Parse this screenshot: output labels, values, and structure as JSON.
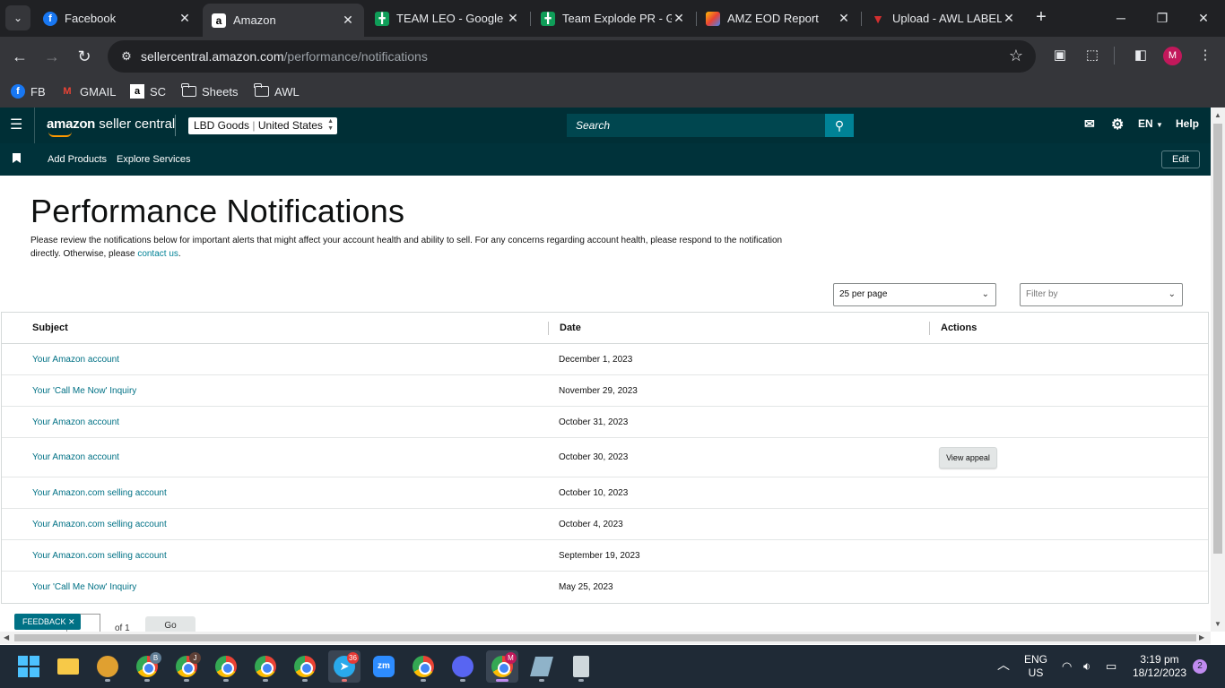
{
  "browser": {
    "tabs": [
      {
        "title": "Facebook",
        "icon": "facebook-icon",
        "color": "#1877f2"
      },
      {
        "title": "Amazon",
        "icon": "amazon-icon",
        "color": "#000000",
        "active": true
      },
      {
        "title": "TEAM LEO - Google S",
        "icon": "google-sheets-icon",
        "color": "#0f9d58"
      },
      {
        "title": "Team Explode PR - G",
        "icon": "google-sheets-icon",
        "color": "#0f9d58"
      },
      {
        "title": "AMZ EOD Report",
        "icon": "report-icon",
        "color": "#f4511e"
      },
      {
        "title": "Upload - AWL LABEL",
        "icon": "awl-label-icon",
        "color": "#d32f2f"
      }
    ],
    "url_host": "sellercentral.amazon.com",
    "url_path": "/performance/notifications",
    "profile_initial": "M",
    "bookmarks": [
      "FB",
      "GMAIL",
      "SC",
      "Sheets",
      "AWL"
    ]
  },
  "header": {
    "logo_bold": "amazon",
    "logo_rest": " seller central",
    "account_store": "LBD Goods",
    "account_region": "United States",
    "search_placeholder": "Search",
    "language": "EN",
    "help": "Help"
  },
  "nav": {
    "add_products": "Add Products",
    "explore_services": "Explore Services",
    "edit": "Edit"
  },
  "page": {
    "title": "Performance Notifications",
    "desc_before": "Please review the notifications below for important alerts that might affect your account health and ability to sell. For any concerns regarding account health, please respond to the notification directly. Otherwise, please ",
    "desc_link": "contact us",
    "desc_after": ".",
    "per_page": "25 per page",
    "filter_placeholder": "Filter by"
  },
  "table": {
    "headers": {
      "subject": "Subject",
      "date": "Date",
      "actions": "Actions"
    },
    "rows": [
      {
        "subject": "Your Amazon account",
        "date": "December 1, 2023",
        "action": ""
      },
      {
        "subject": "Your 'Call Me Now' Inquiry",
        "date": "November 29, 2023",
        "action": ""
      },
      {
        "subject": "Your Amazon account",
        "date": "October 31, 2023",
        "action": ""
      },
      {
        "subject": "Your Amazon account",
        "date": "October 30, 2023",
        "action": "View appeal"
      },
      {
        "subject": "Your Amazon.com selling account",
        "date": "October 10, 2023",
        "action": ""
      },
      {
        "subject": "Your Amazon.com selling account",
        "date": "October 4, 2023",
        "action": ""
      },
      {
        "subject": "Your Amazon.com selling account",
        "date": "September 19, 2023",
        "action": ""
      },
      {
        "subject": "Your 'Call Me Now' Inquiry",
        "date": "May 25, 2023",
        "action": ""
      }
    ]
  },
  "footer": {
    "feedback": "FEEDBACK",
    "of_pages": "of 1",
    "go": "Go"
  },
  "taskbar": {
    "badges": {
      "chrome_b": "B",
      "chrome_j": "J",
      "telegram": "36",
      "chrome_m": "M"
    },
    "lang_top": "ENG",
    "lang_bottom": "US",
    "time": "3:19 pm",
    "date": "18/12/2023",
    "notifications": "2"
  }
}
